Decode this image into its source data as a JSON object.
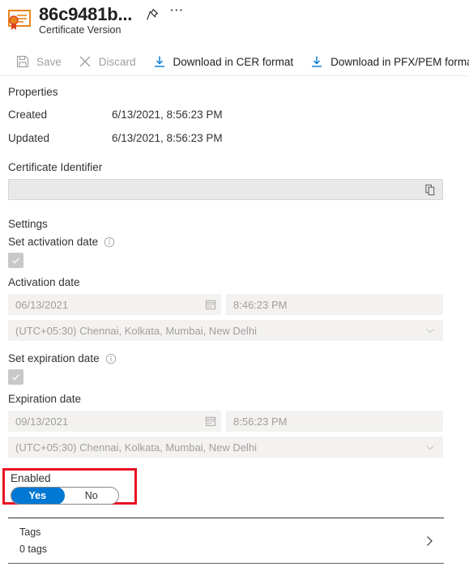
{
  "header": {
    "title": "86c9481b...",
    "subtitle": "Certificate Version",
    "cert_icon": "certificate-icon",
    "pin_icon": "pin-icon",
    "more_icon": "ellipsis-icon"
  },
  "commandbar": {
    "items": [
      {
        "label": "Save",
        "icon": "save-icon",
        "disabled": true
      },
      {
        "label": "Discard",
        "icon": "discard-x-icon",
        "disabled": true
      },
      {
        "label": "Download in CER format",
        "icon": "download-icon",
        "disabled": false
      },
      {
        "label": "Download in PFX/PEM format",
        "icon": "download-icon",
        "disabled": false
      }
    ]
  },
  "properties": {
    "heading": "Properties",
    "rows": [
      {
        "key": "Created",
        "value": "6/13/2021, 8:56:23 PM"
      },
      {
        "key": "Updated",
        "value": "6/13/2021, 8:56:23 PM"
      }
    ],
    "identifier_label": "Certificate Identifier",
    "identifier_value": "",
    "copy_icon": "copy-icon"
  },
  "settings": {
    "heading": "Settings",
    "activation": {
      "checkbox_label": "Set activation date",
      "info_icon": "info-icon",
      "checked": true,
      "enabled": false,
      "date_label": "Activation date",
      "date_value": "06/13/2021",
      "time_value": "8:46:23 PM",
      "timezone_value": "(UTC+05:30) Chennai, Kolkata, Mumbai, New Delhi",
      "calendar_icon": "calendar-icon",
      "chevron_icon": "chevron-down-icon"
    },
    "expiration": {
      "checkbox_label": "Set expiration date",
      "info_icon": "info-icon",
      "checked": true,
      "enabled": false,
      "date_label": "Expiration date",
      "date_value": "09/13/2021",
      "time_value": "8:56:23 PM",
      "timezone_value": "(UTC+05:30) Chennai, Kolkata, Mumbai, New Delhi",
      "calendar_icon": "calendar-icon",
      "chevron_icon": "chevron-down-icon"
    },
    "enabled": {
      "label": "Enabled",
      "yes_label": "Yes",
      "no_label": "No",
      "selected": "Yes",
      "highlight_color": "#e81123",
      "accent_color": "#0078d4"
    }
  },
  "tags": {
    "title": "Tags",
    "count_label": "0 tags",
    "chevron_icon": "chevron-right-icon"
  }
}
